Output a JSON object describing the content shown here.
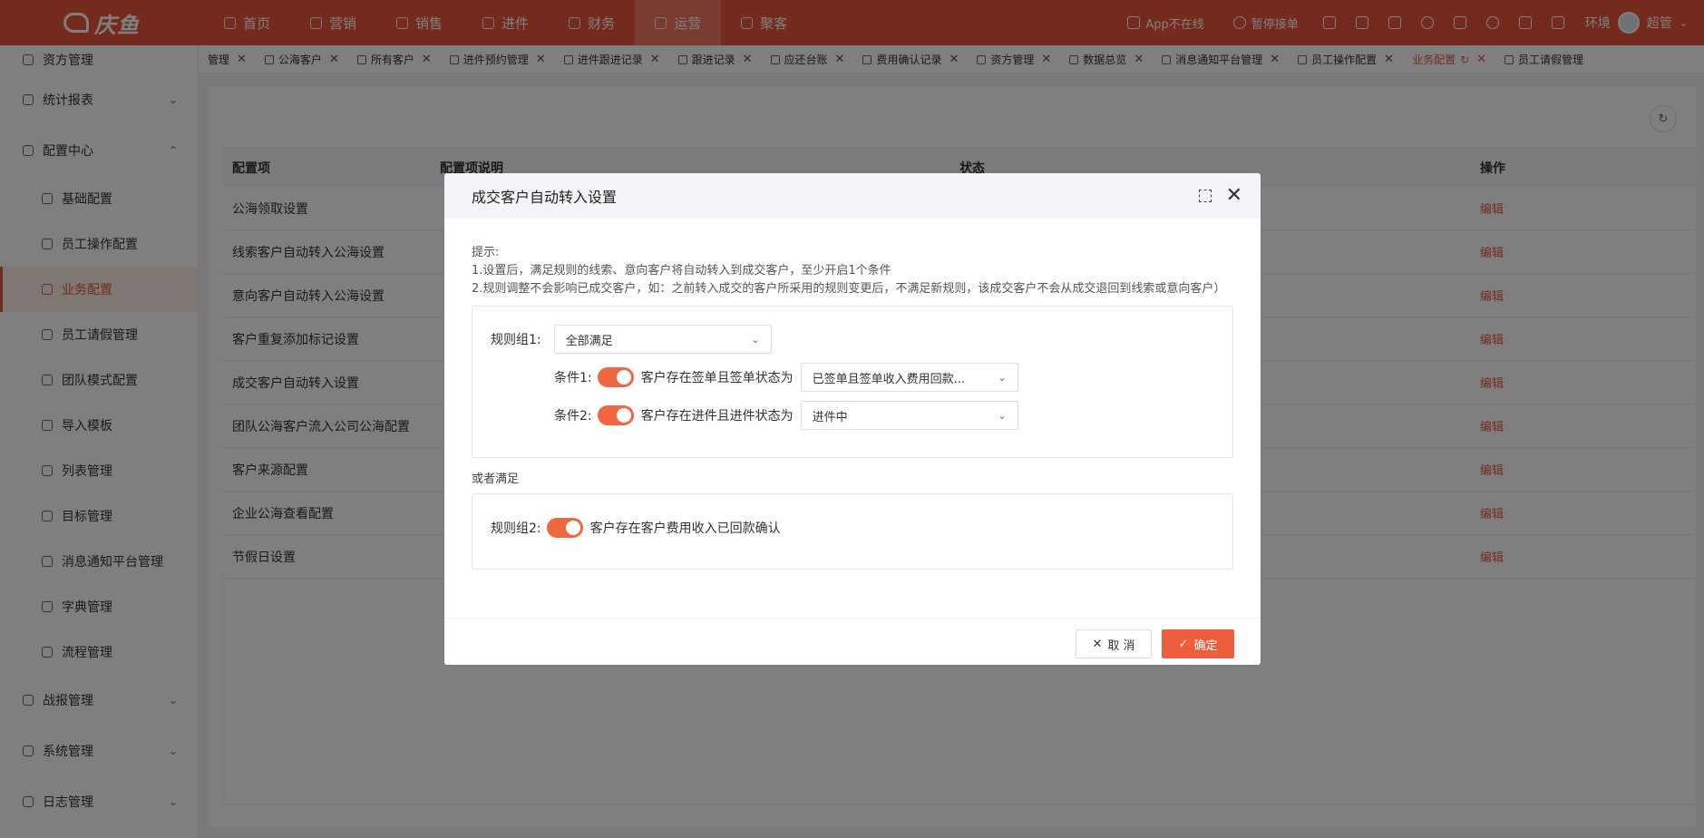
{
  "brand": {
    "name": "庆鱼"
  },
  "nav": [
    {
      "label": "首页",
      "icon": "home-icon"
    },
    {
      "label": "营销",
      "icon": "marketing-icon"
    },
    {
      "label": "销售",
      "icon": "sales-icon"
    },
    {
      "label": "进件",
      "icon": "application-icon"
    },
    {
      "label": "财务",
      "icon": "finance-icon"
    },
    {
      "label": "运营",
      "icon": "operations-icon"
    },
    {
      "label": "聚客",
      "icon": "customers-icon"
    }
  ],
  "tools": {
    "app_status": "App不在线",
    "pause_orders": "暂停接单",
    "env": "环境",
    "user": "超管"
  },
  "sidebar": {
    "top": "资方管理",
    "groups": [
      {
        "label": "统计报表"
      },
      {
        "label": "配置中心"
      }
    ],
    "config_items": [
      "基础配置",
      "员工操作配置",
      "业务配置",
      "员工请假管理",
      "团队模式配置",
      "导入模板",
      "列表管理",
      "目标管理",
      "消息通知平台管理",
      "字典管理",
      "流程管理"
    ],
    "bottom": [
      "战报管理",
      "系统管理",
      "日志管理"
    ]
  },
  "tabs": [
    "管理",
    "公海客户",
    "所有客户",
    "进件预约管理",
    "进件跟进记录",
    "跟进记录",
    "应还台账",
    "费用确认记录",
    "资方管理",
    "数据总览",
    "消息通知平台管理",
    "员工操作配置",
    "业务配置",
    "员工请假管理"
  ],
  "table": {
    "headers": [
      "配置项",
      "配置项说明",
      "状态",
      "操作"
    ],
    "rows": [
      "公海领取设置",
      "线索客户自动转入公海设置",
      "意向客户自动转入公海设置",
      "客户重复添加标记设置",
      "成交客户自动转入设置",
      "团队公海客户流入公司公海配置",
      "客户来源配置",
      "企业公海查看配置",
      "节假日设置"
    ],
    "action": "编辑"
  },
  "modal": {
    "title": "成交客户自动转入设置",
    "hint_title": "提示:",
    "hint_1": "1.设置后，满足规则的线索、意向客户将自动转入到成交客户，至少开启1个条件",
    "hint_2": "2.规则调整不会影响已成交客户，如：之前转入成交的客户所采用的规则变更后，不满足新规则，该成交客户不会从成交退回到线索或意向客户）",
    "group1_label": "规则组1:",
    "group1_select": "全部满足",
    "cond1_label": "条件1:",
    "cond1_text": "客户存在签单且签单状态为",
    "cond1_select": "已签单且签单收入费用回款...",
    "cond2_label": "条件2:",
    "cond2_text": "客户存在进件且进件状态为",
    "cond2_select": "进件中",
    "or_label": "或者满足",
    "group2_label": "规则组2:",
    "group2_text": "客户存在客户费用收入已回款确认",
    "cancel": "取 消",
    "confirm": "确定"
  },
  "colors": {
    "brand": "#e8563a",
    "toggle": "#ee6741"
  }
}
